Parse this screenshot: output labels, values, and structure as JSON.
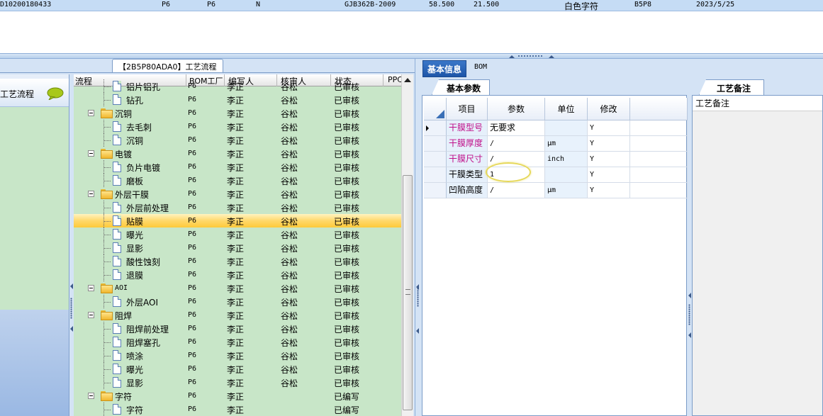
{
  "top_row": {
    "cells": [
      "D10200180433",
      "P6",
      "P6",
      "N",
      "GJB362B-2009",
      "58.500",
      "21.500",
      "白色字符",
      "B5P8",
      "2023/5/25"
    ]
  },
  "left_panel": {
    "tab_title": "【2B5P80ADA0】工艺流程",
    "side_nav_title": "工艺流程",
    "side_nav_icon": "speech-bubble-icon"
  },
  "tree": {
    "headers": [
      "流程",
      "BOM工厂",
      "编写人",
      "核审人",
      "状态",
      "PPC"
    ],
    "rows": [
      {
        "name": "铝片铝孔",
        "level": 1,
        "type": "doc",
        "bom": "P6",
        "writer": "李正",
        "checker": "谷松",
        "status": "已审核"
      },
      {
        "name": "钻孔",
        "level": 1,
        "type": "doc",
        "bom": "P6",
        "writer": "李正",
        "checker": "谷松",
        "status": "已审核"
      },
      {
        "name": "沉铜",
        "level": 0,
        "type": "folder",
        "bom": "P6",
        "writer": "李正",
        "checker": "谷松",
        "status": "已审核"
      },
      {
        "name": "去毛刺",
        "level": 1,
        "type": "doc",
        "bom": "P6",
        "writer": "李正",
        "checker": "谷松",
        "status": "已审核"
      },
      {
        "name": "沉铜",
        "level": 1,
        "type": "doc",
        "bom": "P6",
        "writer": "李正",
        "checker": "谷松",
        "status": "已审核"
      },
      {
        "name": "电镀",
        "level": 0,
        "type": "folder",
        "bom": "P6",
        "writer": "李正",
        "checker": "谷松",
        "status": "已审核"
      },
      {
        "name": "负片电镀",
        "level": 1,
        "type": "doc",
        "bom": "P6",
        "writer": "李正",
        "checker": "谷松",
        "status": "已审核"
      },
      {
        "name": "磨板",
        "level": 1,
        "type": "doc",
        "bom": "P6",
        "writer": "李正",
        "checker": "谷松",
        "status": "已审核"
      },
      {
        "name": "外层干膜",
        "level": 0,
        "type": "folder",
        "bom": "P6",
        "writer": "李正",
        "checker": "谷松",
        "status": "已审核"
      },
      {
        "name": "外层前处理",
        "level": 1,
        "type": "doc",
        "bom": "P6",
        "writer": "李正",
        "checker": "谷松",
        "status": "已审核"
      },
      {
        "name": "贴膜",
        "level": 1,
        "type": "doc",
        "bom": "P6",
        "writer": "李正",
        "checker": "谷松",
        "status": "已审核",
        "selected": true
      },
      {
        "name": "曝光",
        "level": 1,
        "type": "doc",
        "bom": "P6",
        "writer": "李正",
        "checker": "谷松",
        "status": "已审核"
      },
      {
        "name": "显影",
        "level": 1,
        "type": "doc",
        "bom": "P6",
        "writer": "李正",
        "checker": "谷松",
        "status": "已审核"
      },
      {
        "name": "酸性蚀刻",
        "level": 1,
        "type": "doc",
        "bom": "P6",
        "writer": "李正",
        "checker": "谷松",
        "status": "已审核"
      },
      {
        "name": "退膜",
        "level": 1,
        "type": "doc",
        "bom": "P6",
        "writer": "李正",
        "checker": "谷松",
        "status": "已审核"
      },
      {
        "name": "AOI",
        "level": 0,
        "type": "folder",
        "bom": "P6",
        "writer": "李正",
        "checker": "谷松",
        "status": "已审核"
      },
      {
        "name": "外层AOI",
        "level": 1,
        "type": "doc",
        "bom": "P6",
        "writer": "李正",
        "checker": "谷松",
        "status": "已审核"
      },
      {
        "name": "阻焊",
        "level": 0,
        "type": "folder",
        "bom": "P6",
        "writer": "李正",
        "checker": "谷松",
        "status": "已审核"
      },
      {
        "name": "阻焊前处理",
        "level": 1,
        "type": "doc",
        "bom": "P6",
        "writer": "李正",
        "checker": "谷松",
        "status": "已审核"
      },
      {
        "name": "阻焊塞孔",
        "level": 1,
        "type": "doc",
        "bom": "P6",
        "writer": "李正",
        "checker": "谷松",
        "status": "已审核"
      },
      {
        "name": "喷涂",
        "level": 1,
        "type": "doc",
        "bom": "P6",
        "writer": "李正",
        "checker": "谷松",
        "status": "已审核"
      },
      {
        "name": "曝光",
        "level": 1,
        "type": "doc",
        "bom": "P6",
        "writer": "李正",
        "checker": "谷松",
        "status": "已审核"
      },
      {
        "name": "显影",
        "level": 1,
        "type": "doc",
        "bom": "P6",
        "writer": "李正",
        "checker": "谷松",
        "status": "已审核"
      },
      {
        "name": "字符",
        "level": 0,
        "type": "folder",
        "bom": "P6",
        "writer": "李正",
        "checker": "",
        "status": "已编写"
      },
      {
        "name": "字符",
        "level": 1,
        "type": "doc",
        "bom": "P6",
        "writer": "李正",
        "checker": "",
        "status": "已编写"
      }
    ]
  },
  "right_tabs": {
    "basic_info": "基本信息",
    "bom": "BOM"
  },
  "params": {
    "tab_title": "基本参数",
    "headers": [
      "项目",
      "参数",
      "单位",
      "修改"
    ],
    "rows": [
      {
        "name": "干膜型号",
        "value": "无要求",
        "unit": "",
        "modify": "Y",
        "pink": true,
        "current": true
      },
      {
        "name": "干膜厚度",
        "value": "/",
        "unit": "μm",
        "modify": "Y",
        "pink": true
      },
      {
        "name": "干膜尺寸",
        "value": "/",
        "unit": "inch",
        "modify": "Y",
        "pink": true
      },
      {
        "name": "干膜类型",
        "value": "1",
        "unit": "",
        "modify": "Y",
        "pink": false
      },
      {
        "name": "凹陷高度",
        "value": "/",
        "unit": "μm",
        "modify": "Y",
        "pink": false
      }
    ]
  },
  "notes": {
    "tab_title": "工艺备注",
    "label": "工艺备注"
  },
  "colors": {
    "tree_bg": "#c8e6c8",
    "selected_row": "#ffd86a",
    "pink_label": "#c0108a",
    "panel_bg": "#d4e3f5"
  }
}
